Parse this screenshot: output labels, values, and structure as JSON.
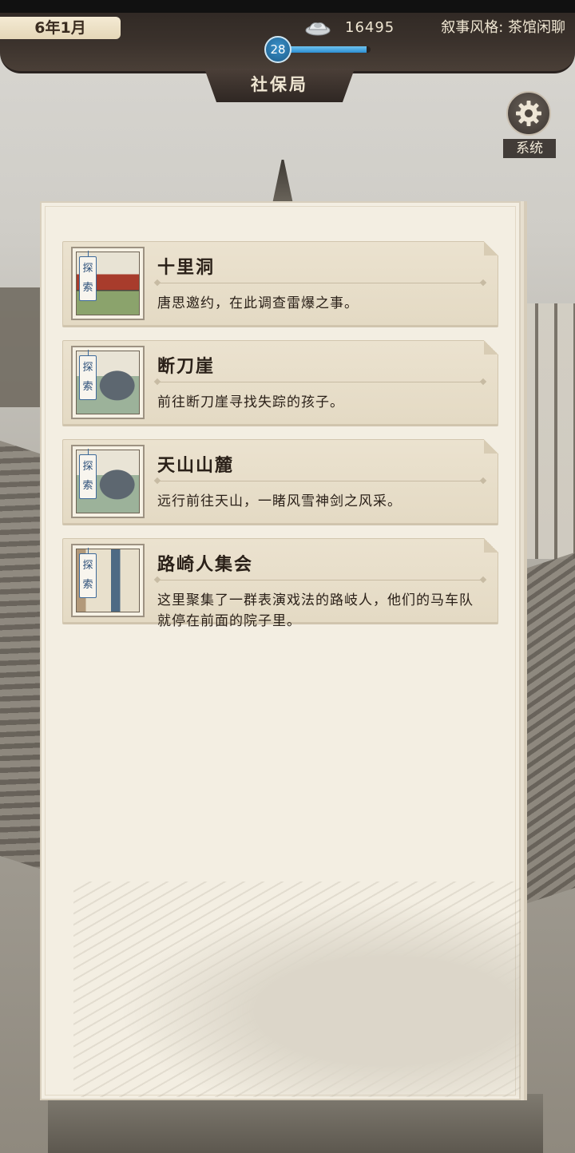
{
  "header": {
    "date": "6年1月",
    "silver_icon": "silver-ingot-icon",
    "silver_amount": "16495",
    "narrative_style": "叙事风格: 茶馆闲聊",
    "level": "28",
    "level_progress": 0.95,
    "location": "社保局"
  },
  "system": {
    "label": "系统",
    "icon": "gear-icon"
  },
  "quests": [
    {
      "tag": "探索",
      "title": "十里洞",
      "description": "唐思邀约，在此调查雷爆之事。"
    },
    {
      "tag": "探索",
      "title": "断刀崖",
      "description": "前往断刀崖寻找失踪的孩子。"
    },
    {
      "tag": "探索",
      "title": "天山山麓",
      "description": "远行前往天山，一睹风雪神剑之风采。"
    },
    {
      "tag": "探索",
      "title": "路崎人集会",
      "description": "这里聚集了一群表演戏法的路岐人，他们的马车队就停在前面的院子里。"
    }
  ],
  "colors": {
    "topbar": "#3b322c",
    "panel": "#f3eee2",
    "level_blue": "#2d8fd2",
    "tag_blue": "#2b4e78"
  }
}
